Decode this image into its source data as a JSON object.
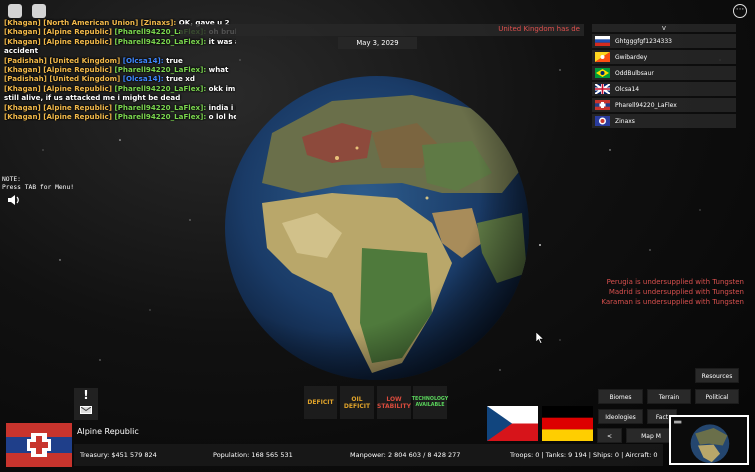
{
  "chat": [
    {
      "tag": "[Khagan] [North American Union] [Zinaxs]:",
      "name_style": "tag",
      "msg": "OK, gave u 2"
    },
    {
      "tag": "[Khagan] [Alpine Republic]",
      "name": "[Pharell94220_LaFlex]:",
      "name_style": "green",
      "msg": "oh bruh"
    },
    {
      "tag": "[Khagan] [Alpine Republic]",
      "name": "[Pharell94220_LaFlex]:",
      "name_style": "green",
      "msg": "it was an"
    },
    {
      "tag": "",
      "name": "",
      "msg": "accident"
    },
    {
      "tag": "[Padishah] [United Kingdom]",
      "name": "[Olcsa14]:",
      "name_style": "blue",
      "msg": "true"
    },
    {
      "tag": "[Khagan] [Alpine Republic]",
      "name": "[Pharell94220_LaFlex]:",
      "name_style": "green",
      "msg": "what"
    },
    {
      "tag": "[Padishah] [United Kingdom]",
      "name": "[Olcsa14]:",
      "name_style": "blue",
      "msg": "true xd"
    },
    {
      "tag": "[Khagan] [Alpine Republic]",
      "name": "[Pharell94220_LaFlex]:",
      "name_style": "green",
      "msg": "okk im"
    },
    {
      "tag": "",
      "name": "",
      "msg": "still alive, if us attacked me i might be dead"
    },
    {
      "tag": "[Khagan] [Alpine Republic]",
      "name": "[Pharell94220_LaFlex]:",
      "name_style": "green",
      "msg": "india i gtg"
    },
    {
      "tag": "[Khagan] [Alpine Republic]",
      "name": "[Pharell94220_LaFlex]:",
      "name_style": "green",
      "msg": "o lol he"
    }
  ],
  "news": "United Kingdom has de",
  "date": "May 3, 2029",
  "players": {
    "toggle": "v",
    "list": [
      {
        "name": "Ghtgggfgf1234333",
        "flag": "russia"
      },
      {
        "name": "Gwibardey",
        "flag": "bhutan"
      },
      {
        "name": "OddBulbsaur",
        "flag": "brazil"
      },
      {
        "name": "Olcsa14",
        "flag": "uk"
      },
      {
        "name": "Pharell94220_LaFlex",
        "flag": "alpine"
      },
      {
        "name": "Zinaxs",
        "flag": "nau"
      }
    ]
  },
  "note": [
    "NOTE:",
    "Press TAB for Menu!"
  ],
  "alerts": [
    "Perugia is undersupplied with Tungsten",
    "Madrid is undersupplied with Tungsten",
    "Karaman is undersupplied with Tungsten"
  ],
  "status": {
    "deficit": "DEFICIT",
    "oil_deficit": [
      "OIL",
      "DEFICIT"
    ],
    "low_stability": [
      "LOW",
      "STABILITY"
    ],
    "technology": [
      "TECHNOLOGY",
      "AVAILABLE"
    ]
  },
  "nation": {
    "name": "Alpine Republic"
  },
  "stats": {
    "treasury": "Treasury: $451 579 824",
    "population": "Population: 168 565 531",
    "manpower": "Manpower: 2 804 603 / 8 428 277",
    "troops": "Troops: 0 | Tanks: 9 194 | Ships: 0 | Aircraft: 0"
  },
  "map_buttons": {
    "resources": "Resources",
    "biomes": "Biomes",
    "terrain": "Terrain",
    "political": "Political",
    "ideologies": "Ideologies",
    "factions": "Fact",
    "back": "<",
    "map_modes": "Map M"
  },
  "icons": {
    "top_left_1": "roblox-icon",
    "top_left_2": "chat-icon",
    "menu": "menu-dots-icon",
    "sound": "speaker-icon",
    "mail": "mail-icon",
    "cursor": "cursor-icon"
  },
  "colors": {
    "warning": "#e1a42a",
    "danger": "#d94b3d",
    "success": "#5ad55c",
    "news": "#e0514e"
  }
}
